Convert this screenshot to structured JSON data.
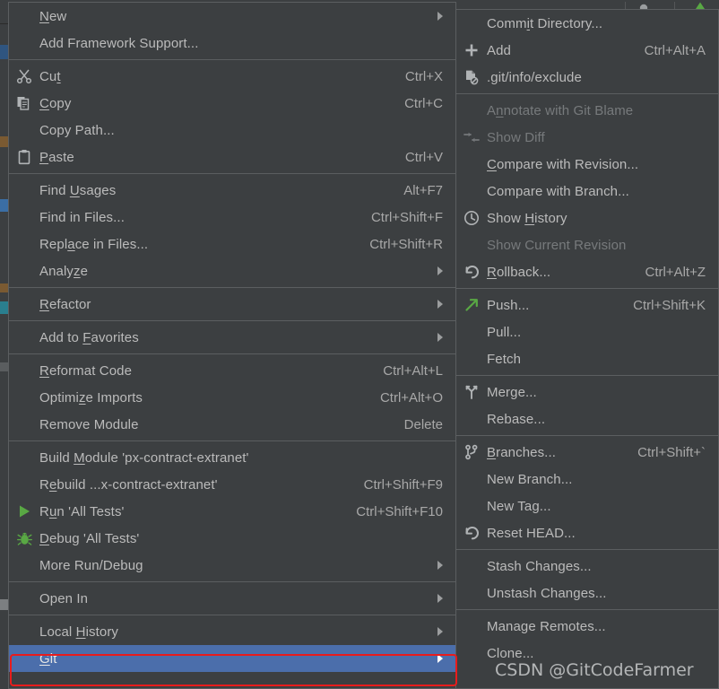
{
  "colors": {
    "menu_background": "#3c3f41",
    "menu_border": "#5b5e60",
    "text": "#bbbbbb",
    "text_disabled": "#777a7c",
    "selection": "#4b6eab",
    "highlight_outline": "#e81c1c",
    "accent_green": "#62a850"
  },
  "background": {
    "toolbar_user_icon": "user-avatar-icon",
    "toolbar_user_caret": "chevron-down-icon",
    "toolbar_update_icon": "green-chevron-up-icon"
  },
  "context_menu": {
    "name": "project-view-context-menu",
    "groups": [
      {
        "items": [
          {
            "label": "New",
            "mnemonic": "N",
            "accel": "",
            "icon": "",
            "submenu": true,
            "disabled": false
          },
          {
            "label": "Add Framework Support...",
            "mnemonic": "",
            "accel": "",
            "icon": "",
            "submenu": false,
            "disabled": false
          }
        ]
      },
      {
        "items": [
          {
            "label": "Cut",
            "mnemonic": "t",
            "accel": "Ctrl+X",
            "icon": "scissors-icon",
            "submenu": false,
            "disabled": false
          },
          {
            "label": "Copy",
            "mnemonic": "C",
            "accel": "Ctrl+C",
            "icon": "copy-icon",
            "submenu": false,
            "disabled": false
          },
          {
            "label": "Copy Path...",
            "mnemonic": "",
            "accel": "",
            "icon": "",
            "submenu": false,
            "disabled": false
          },
          {
            "label": "Paste",
            "mnemonic": "P",
            "accel": "Ctrl+V",
            "icon": "clipboard-icon",
            "submenu": false,
            "disabled": false
          }
        ]
      },
      {
        "items": [
          {
            "label": "Find Usages",
            "mnemonic": "U",
            "accel": "Alt+F7",
            "icon": "",
            "submenu": false,
            "disabled": false
          },
          {
            "label": "Find in Files...",
            "mnemonic": "",
            "accel": "Ctrl+Shift+F",
            "icon": "",
            "submenu": false,
            "disabled": false
          },
          {
            "label": "Replace in Files...",
            "mnemonic": "a",
            "accel": "Ctrl+Shift+R",
            "icon": "",
            "submenu": false,
            "disabled": false
          },
          {
            "label": "Analyze",
            "mnemonic": "z",
            "accel": "",
            "icon": "",
            "submenu": true,
            "disabled": false
          }
        ]
      },
      {
        "items": [
          {
            "label": "Refactor",
            "mnemonic": "R",
            "accel": "",
            "icon": "",
            "submenu": true,
            "disabled": false
          }
        ]
      },
      {
        "items": [
          {
            "label": "Add to Favorites",
            "mnemonic": "F",
            "accel": "",
            "icon": "",
            "submenu": true,
            "disabled": false
          }
        ]
      },
      {
        "items": [
          {
            "label": "Reformat Code",
            "mnemonic": "R",
            "accel": "Ctrl+Alt+L",
            "icon": "",
            "submenu": false,
            "disabled": false
          },
          {
            "label": "Optimize Imports",
            "mnemonic": "z",
            "accel": "Ctrl+Alt+O",
            "icon": "",
            "submenu": false,
            "disabled": false
          },
          {
            "label": "Remove Module",
            "mnemonic": "",
            "accel": "Delete",
            "icon": "",
            "submenu": false,
            "disabled": false
          }
        ]
      },
      {
        "items": [
          {
            "label": "Build Module 'px-contract-extranet'",
            "mnemonic": "M",
            "accel": "",
            "icon": "",
            "submenu": false,
            "disabled": false
          },
          {
            "label": "Rebuild ...x-contract-extranet'",
            "mnemonic": "e",
            "accel": "Ctrl+Shift+F9",
            "icon": "",
            "submenu": false,
            "disabled": false
          },
          {
            "label": "Run 'All Tests'",
            "mnemonic": "u",
            "accel": "Ctrl+Shift+F10",
            "icon": "run-green-triangle-icon",
            "submenu": false,
            "disabled": false
          },
          {
            "label": "Debug 'All Tests'",
            "mnemonic": "D",
            "accel": "",
            "icon": "debug-bug-icon",
            "submenu": false,
            "disabled": false
          },
          {
            "label": "More Run/Debug",
            "mnemonic": "",
            "accel": "",
            "icon": "",
            "submenu": true,
            "disabled": false
          }
        ]
      },
      {
        "items": [
          {
            "label": "Open In",
            "mnemonic": "",
            "accel": "",
            "icon": "",
            "submenu": true,
            "disabled": false
          }
        ]
      },
      {
        "items": [
          {
            "label": "Local History",
            "mnemonic": "H",
            "accel": "",
            "icon": "",
            "submenu": true,
            "disabled": false
          },
          {
            "label": "Git",
            "mnemonic": "G",
            "accel": "",
            "icon": "",
            "submenu": true,
            "disabled": false,
            "selected": true
          }
        ]
      }
    ]
  },
  "git_submenu": {
    "name": "git-submenu",
    "groups": [
      {
        "items": [
          {
            "label": "Commit Directory...",
            "mnemonic": "i",
            "accel": "",
            "icon": "",
            "submenu": false,
            "disabled": false
          },
          {
            "label": "Add",
            "mnemonic": "",
            "accel": "Ctrl+Alt+A",
            "icon": "plus-icon",
            "submenu": false,
            "disabled": false
          },
          {
            "label": ".git/info/exclude",
            "mnemonic": "",
            "accel": "",
            "icon": "file-excluded-icon",
            "submenu": false,
            "disabled": false
          }
        ]
      },
      {
        "items": [
          {
            "label": "Annotate with Git Blame",
            "mnemonic": "n",
            "accel": "",
            "icon": "",
            "submenu": false,
            "disabled": true
          },
          {
            "label": "Show Diff",
            "mnemonic": "",
            "accel": "",
            "icon": "diff-arrows-icon",
            "submenu": false,
            "disabled": true
          },
          {
            "label": "Compare with Revision...",
            "mnemonic": "C",
            "accel": "",
            "icon": "",
            "submenu": false,
            "disabled": false
          },
          {
            "label": "Compare with Branch...",
            "mnemonic": "",
            "accel": "",
            "icon": "",
            "submenu": false,
            "disabled": false
          },
          {
            "label": "Show History",
            "mnemonic": "H",
            "accel": "",
            "icon": "clock-icon",
            "submenu": false,
            "disabled": false
          },
          {
            "label": "Show Current Revision",
            "mnemonic": "",
            "accel": "",
            "icon": "",
            "submenu": false,
            "disabled": true
          },
          {
            "label": "Rollback...",
            "mnemonic": "R",
            "accel": "Ctrl+Alt+Z",
            "icon": "rollback-arrow-icon",
            "submenu": false,
            "disabled": false
          }
        ]
      },
      {
        "items": [
          {
            "label": "Push...",
            "mnemonic": "",
            "accel": "Ctrl+Shift+K",
            "icon": "push-arrow-icon",
            "submenu": false,
            "disabled": false
          },
          {
            "label": "Pull...",
            "mnemonic": "",
            "accel": "",
            "icon": "",
            "submenu": false,
            "disabled": false
          },
          {
            "label": "Fetch",
            "mnemonic": "",
            "accel": "",
            "icon": "",
            "submenu": false,
            "disabled": false
          }
        ]
      },
      {
        "items": [
          {
            "label": "Merge...",
            "mnemonic": "",
            "accel": "",
            "icon": "merge-icon",
            "submenu": false,
            "disabled": false
          },
          {
            "label": "Rebase...",
            "mnemonic": "",
            "accel": "",
            "icon": "",
            "submenu": false,
            "disabled": false
          }
        ]
      },
      {
        "items": [
          {
            "label": "Branches...",
            "mnemonic": "B",
            "accel": "Ctrl+Shift+`",
            "icon": "branch-icon",
            "submenu": false,
            "disabled": false
          },
          {
            "label": "New Branch...",
            "mnemonic": "",
            "accel": "",
            "icon": "",
            "submenu": false,
            "disabled": false
          },
          {
            "label": "New Tag...",
            "mnemonic": "",
            "accel": "",
            "icon": "",
            "submenu": false,
            "disabled": false
          },
          {
            "label": "Reset HEAD...",
            "mnemonic": "",
            "accel": "",
            "icon": "rollback-arrow-icon",
            "submenu": false,
            "disabled": false
          }
        ]
      },
      {
        "items": [
          {
            "label": "Stash Changes...",
            "mnemonic": "",
            "accel": "",
            "icon": "",
            "submenu": false,
            "disabled": false
          },
          {
            "label": "Unstash Changes...",
            "mnemonic": "",
            "accel": "",
            "icon": "",
            "submenu": false,
            "disabled": false
          }
        ]
      },
      {
        "items": [
          {
            "label": "Manage Remotes...",
            "mnemonic": "",
            "accel": "",
            "icon": "",
            "submenu": false,
            "disabled": false
          },
          {
            "label": "Clone...",
            "mnemonic": "",
            "accel": "",
            "icon": "",
            "submenu": false,
            "disabled": false
          }
        ]
      }
    ]
  },
  "watermark": {
    "text": "CSDN @GitCodeFarmer"
  }
}
